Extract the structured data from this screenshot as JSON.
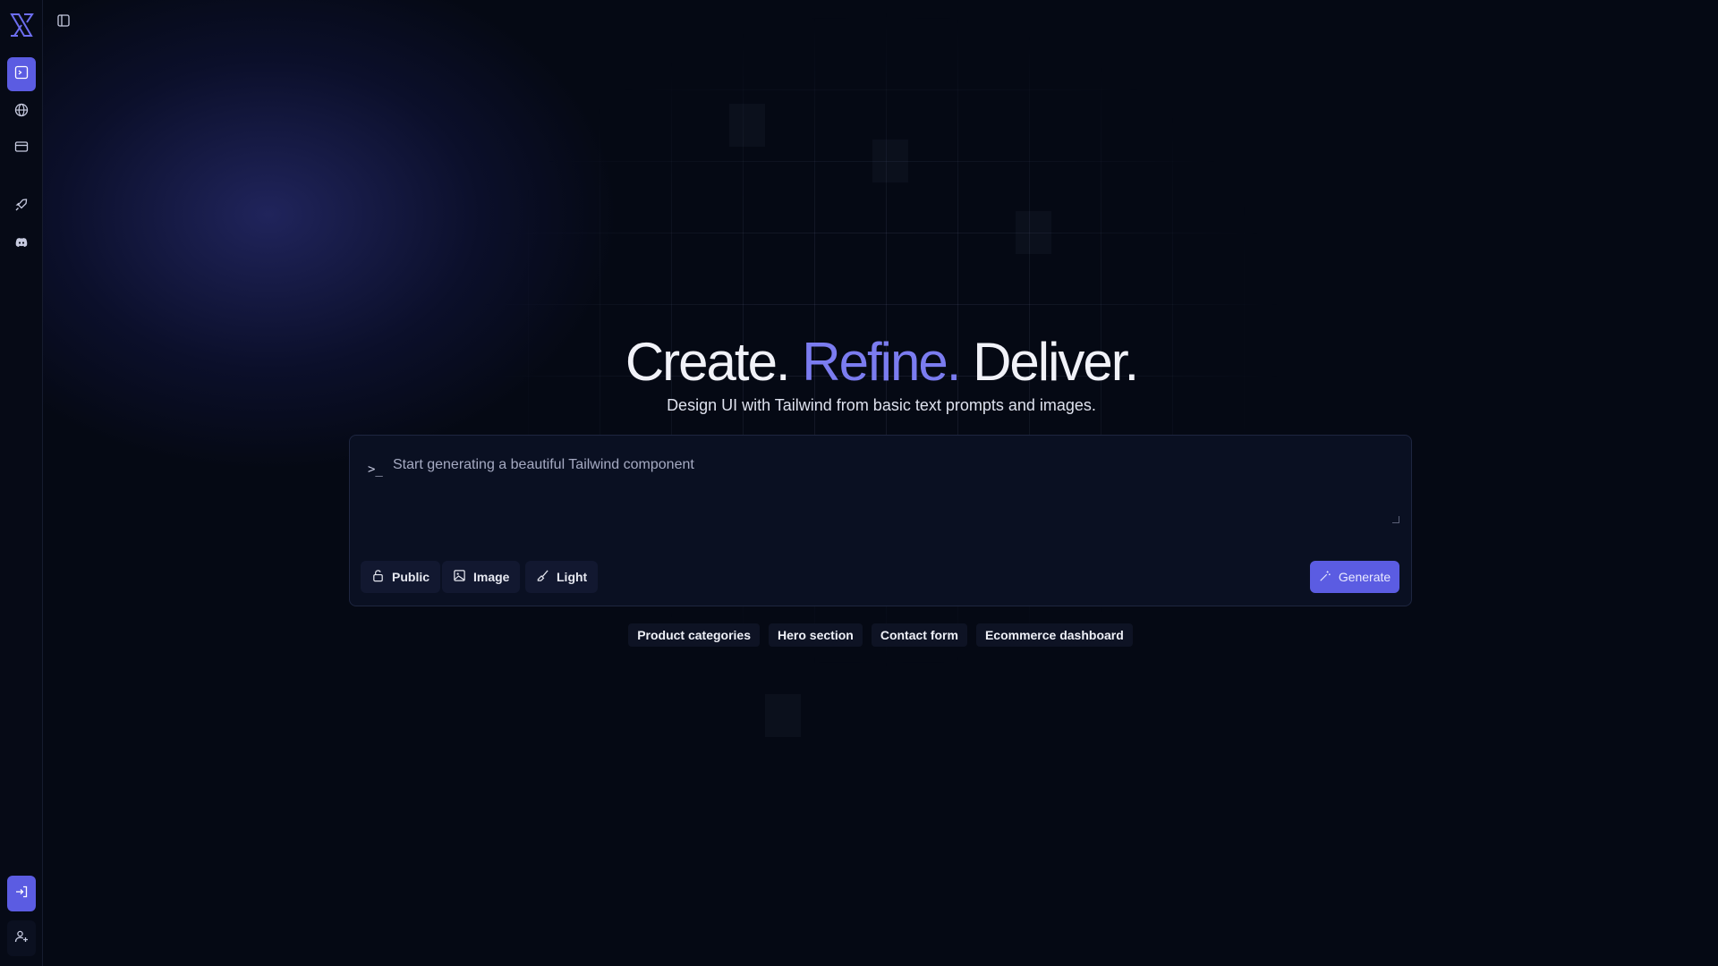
{
  "sidebar": {
    "logo_icon": "x-logo-icon",
    "nav": [
      {
        "name": "terminal-icon",
        "active": true
      },
      {
        "name": "globe-icon",
        "active": false
      },
      {
        "name": "card-icon",
        "active": false
      },
      {
        "name": "rocket-icon",
        "active": false
      },
      {
        "name": "discord-icon",
        "active": false
      }
    ],
    "bottom": [
      {
        "name": "login-icon"
      },
      {
        "name": "add-user-icon"
      }
    ]
  },
  "toggle_icon": "sidebar-toggle-icon",
  "hero": {
    "title_part1": "Create.",
    "title_part2": "Refine.",
    "title_part3": "Deliver.",
    "subtitle": "Design UI with Tailwind from basic text prompts and images."
  },
  "prompt": {
    "prefix": ">_",
    "placeholder": "Start generating a beautiful Tailwind component",
    "value": ""
  },
  "tools": {
    "public_label": "Public",
    "image_label": "Image",
    "light_label": "Light"
  },
  "generate_label": "Generate",
  "suggestions": [
    "Product categories",
    "Hero section",
    "Contact form",
    "Ecommerce dashboard"
  ],
  "colors": {
    "accent": "#5b5ce2",
    "accent_text": "#7b7cf0",
    "background": "#050914"
  }
}
